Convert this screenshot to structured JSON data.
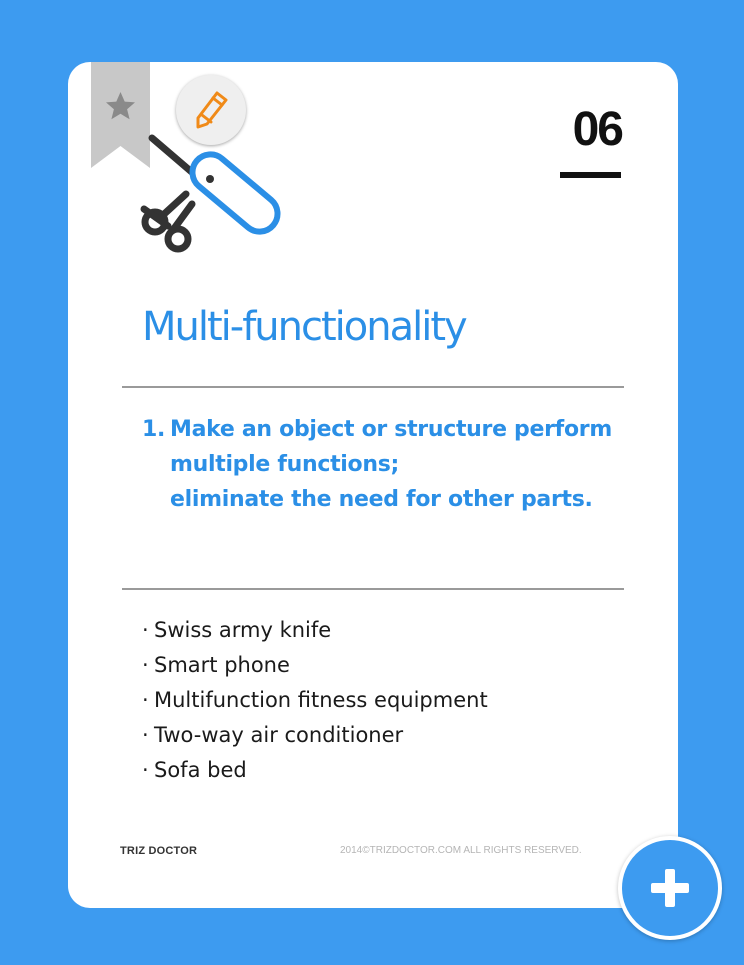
{
  "colors": {
    "background": "#3d9bf0",
    "accent": "#2b8fe6",
    "bookmark": "#c8c8c8",
    "edit_icon": "#f08a18"
  },
  "icons": {
    "bookmark": "star-bookmark-icon",
    "edit": "pencil-icon",
    "illustration": "scissors-knife-icon",
    "fab": "plus-icon"
  },
  "card": {
    "number": "06",
    "title": "Multi-functionality",
    "principle": {
      "number": "1.",
      "lines": [
        "Make an object or structure perform",
        "multiple functions;",
        "eliminate the need for other parts."
      ]
    },
    "examples": [
      "Swiss army knife",
      "Smart phone",
      "Multifunction fitness equipment",
      "Two-way air conditioner",
      "Sofa bed"
    ],
    "footer": {
      "brand": "TRIZ DOCTOR",
      "copyright": "2014©TRIZDOCTOR.COM  ALL RIGHTS RESERVED."
    }
  }
}
